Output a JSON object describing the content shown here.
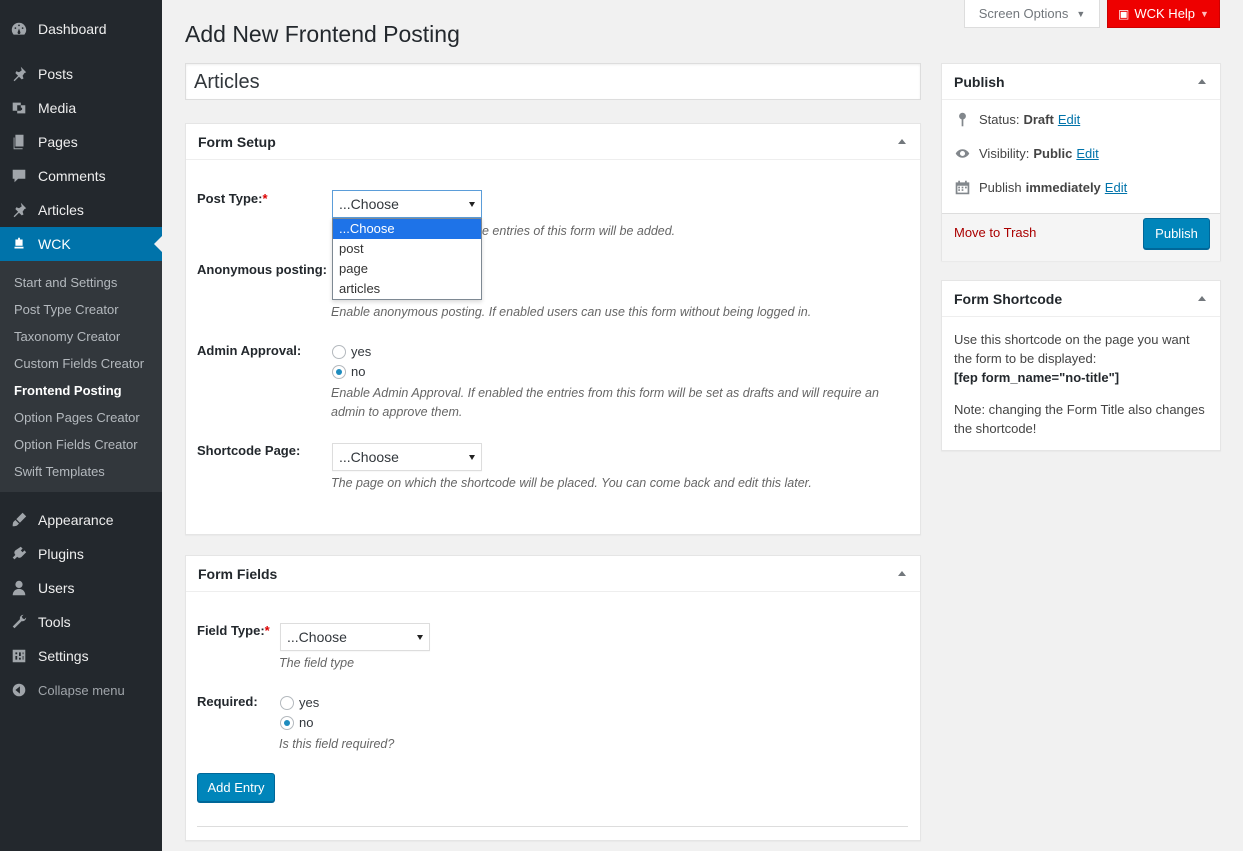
{
  "sidebar": {
    "dashboard": "Dashboard",
    "posts": "Posts",
    "media": "Media",
    "pages": "Pages",
    "comments": "Comments",
    "articles": "Articles",
    "wck": "WCK",
    "submenu": [
      "Start and Settings",
      "Post Type Creator",
      "Taxonomy Creator",
      "Custom Fields Creator",
      "Frontend Posting",
      "Option Pages Creator",
      "Option Fields Creator",
      "Swift Templates"
    ],
    "appearance": "Appearance",
    "plugins": "Plugins",
    "users": "Users",
    "tools": "Tools",
    "settings": "Settings",
    "collapse": "Collapse menu"
  },
  "topbar": {
    "screen_options": "Screen Options",
    "wck_help": "WCK Help"
  },
  "page_title": "Add New Frontend Posting",
  "title_value": "Articles",
  "form_setup": {
    "heading": "Form Setup",
    "post_type_label": "Post Type:",
    "post_type_value": "...Choose",
    "post_type_options": [
      "...Choose",
      "post",
      "page",
      "articles"
    ],
    "post_type_desc_tail": "e entries of this form will be added.",
    "anon_label": "Anonymous posting:",
    "anon_desc": "Enable anonymous posting. If enabled users can use this form without being logged in.",
    "admin_label": "Admin Approval:",
    "admin_yes": "yes",
    "admin_no": "no",
    "admin_desc": "Enable Admin Approval. If enabled the entries from this form will be set as drafts and will require an admin to approve them.",
    "shortcode_label": "Shortcode Page:",
    "shortcode_value": "...Choose",
    "shortcode_desc": "The page on which the shortcode will be placed. You can come back and edit this later."
  },
  "form_fields": {
    "heading": "Form Fields",
    "field_type_label": "Field Type:",
    "field_type_value": "...Choose",
    "field_type_desc": "The field type",
    "required_label": "Required:",
    "req_yes": "yes",
    "req_no": "no",
    "required_desc": "Is this field required?",
    "add_entry": "Add Entry"
  },
  "publish": {
    "heading": "Publish",
    "status_label": "Status:",
    "status_value": "Draft",
    "visibility_label": "Visibility:",
    "visibility_value": "Public",
    "publish_label": "Publish",
    "publish_value": "immediately",
    "edit": "Edit",
    "trash": "Move to Trash",
    "button": "Publish"
  },
  "shortcode_box": {
    "heading": "Form Shortcode",
    "text": "Use this shortcode on the page you want the form to be displayed:",
    "code": "[fep form_name=\"no-title\"]",
    "note": "Note: changing the Form Title also changes the shortcode!"
  },
  "colors": {
    "accent": "#0073aa",
    "sidebar": "#23282d",
    "help": "#e00000"
  }
}
